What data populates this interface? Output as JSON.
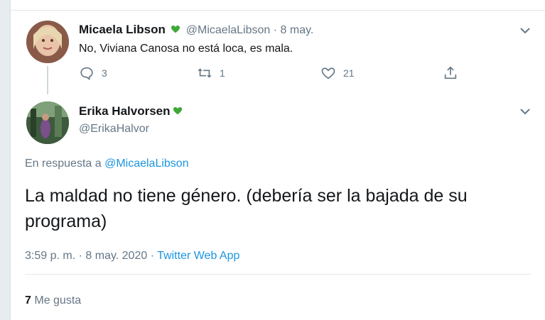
{
  "colors": {
    "accent": "#1b95e0",
    "muted": "#657786",
    "heart_green": "#3ea838"
  },
  "tweet1": {
    "name": "Micaela Libson",
    "name_emoji": "green-heart-icon",
    "handle": "@MicaelaLibson",
    "separator": "·",
    "date": "8 may.",
    "text": "No, Viviana Canosa no está loca, es mala.",
    "replies": "3",
    "retweets": "1",
    "likes": "21"
  },
  "tweet2": {
    "name": "Erika Halvorsen",
    "name_emoji": "green-heart-icon",
    "handle": "@ErikaHalvor",
    "reply_prefix": "En respuesta a",
    "reply_to": "@MicaelaLibson",
    "text": "La maldad no tiene género. (debería ser la bajada de su programa)",
    "timestamp": "3:59 p. m. · 8 may. 2020",
    "dot": "·",
    "source": "Twitter Web App",
    "like_count": "7",
    "like_label": "Me gusta"
  }
}
